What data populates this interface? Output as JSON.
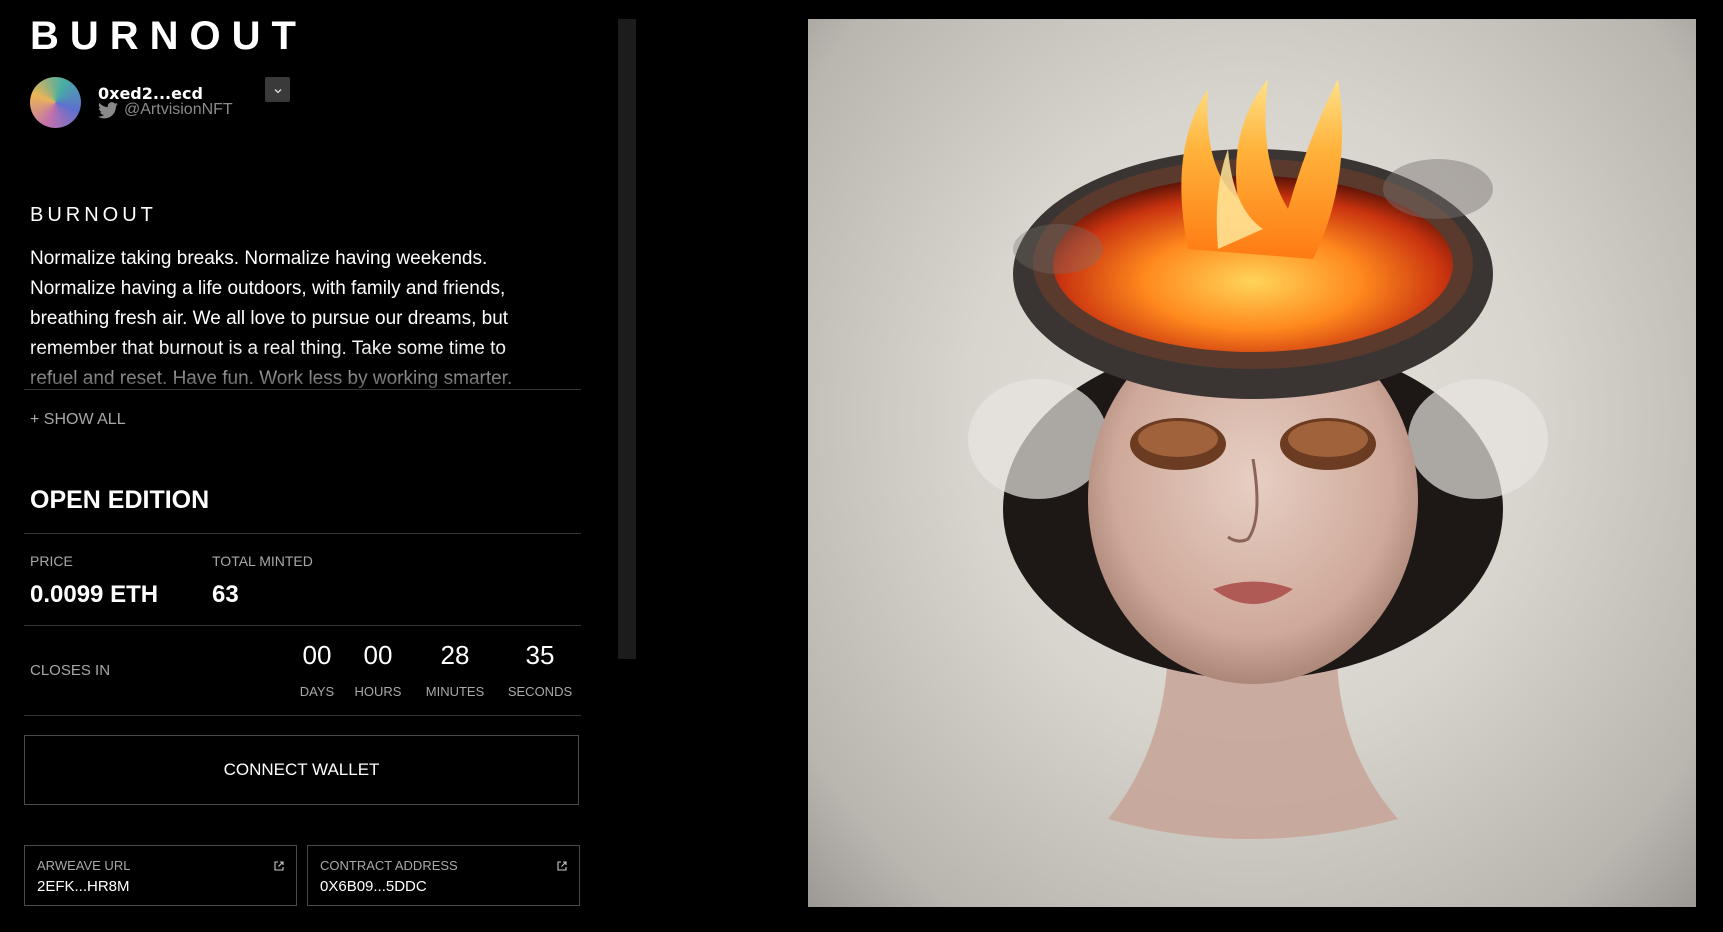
{
  "header": {
    "collection_title": "BURNOUT",
    "creator_address": "0xed2...ecd",
    "creator_twitter": "@ArtvisionNFT"
  },
  "piece": {
    "title": "BURNOUT",
    "description": "Normalize taking breaks. Normalize having weekends. Normalize having a life outdoors, with family and friends, breathing fresh air. We all love to pursue our dreams, but remember that burnout is a real thing. Take some time to refuel and reset. Have fun. Work less by working smarter.",
    "show_all_label": "+ SHOW ALL"
  },
  "edition": {
    "title": "OPEN EDITION",
    "price_label": "PRICE",
    "price_value": "0.0099 ETH",
    "minted_label": "TOTAL MINTED",
    "minted_value": "63"
  },
  "countdown": {
    "label": "CLOSES IN",
    "days": "00",
    "days_label": "DAYS",
    "hours": "00",
    "hours_label": "HOURS",
    "minutes": "28",
    "minutes_label": "MINUTES",
    "seconds": "35",
    "seconds_label": "SECONDS"
  },
  "actions": {
    "connect_wallet": "CONNECT WALLET"
  },
  "links": {
    "arweave_label": "ARWEAVE URL",
    "arweave_value": "2EFK...HR8M",
    "contract_label": "CONTRACT ADDRESS",
    "contract_value": "0X6B09...5DDC"
  },
  "icons": {
    "twitter": "twitter-icon",
    "dropdown": "chevron-down-icon",
    "external": "external-link-icon"
  },
  "colors": {
    "background": "#000000",
    "border": "#4a4a4a",
    "muted_text": "#a8a8a8",
    "twitter_gray": "#8a8a8a"
  }
}
